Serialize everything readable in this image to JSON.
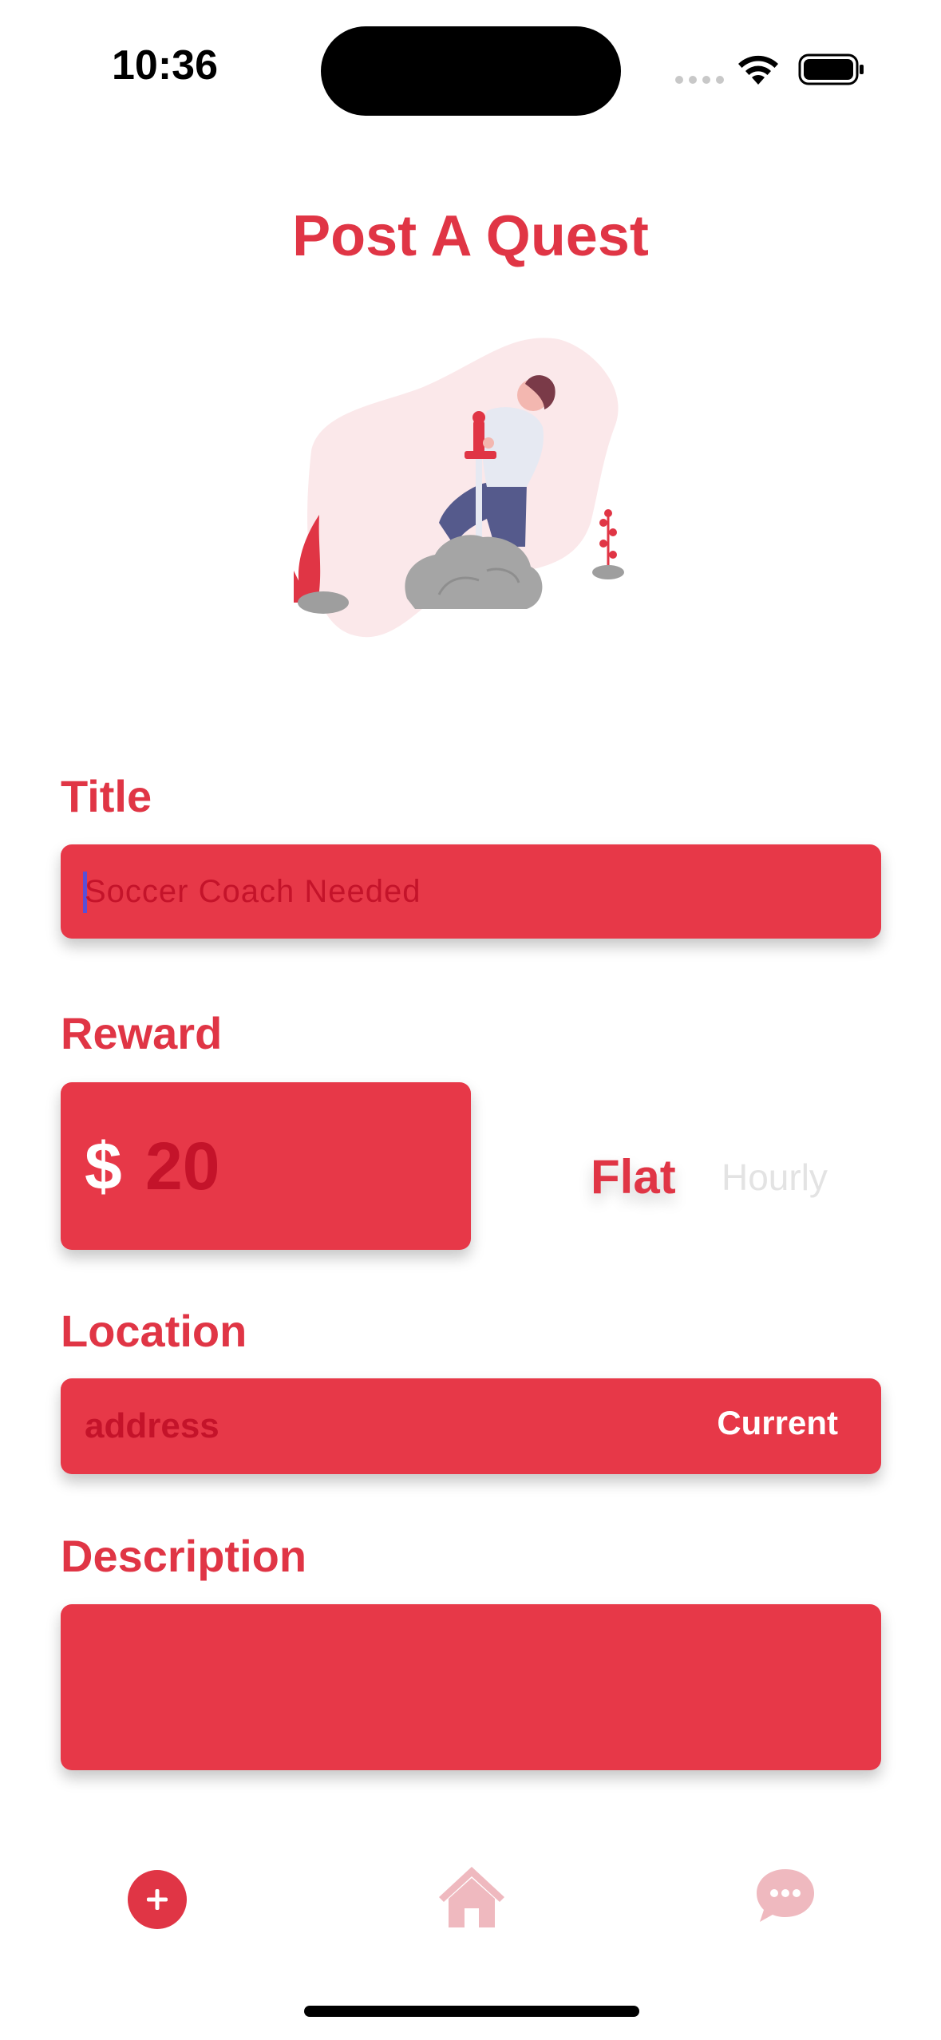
{
  "status_bar": {
    "time": "10:36"
  },
  "header": {
    "title": "Post A Quest"
  },
  "form": {
    "title_label": "Title",
    "title_value": "Soccer Coach Needed",
    "reward_label": "Reward",
    "reward_currency": "$",
    "reward_value": "20",
    "rate_flat": "Flat",
    "rate_hourly": "Hourly",
    "rate_selected": "Flat",
    "location_label": "Location",
    "location_placeholder": "address",
    "location_current_button": "Current",
    "description_label": "Description",
    "description_value": ""
  },
  "tab_bar": {
    "items": [
      {
        "icon": "plus-circle-icon",
        "active": true
      },
      {
        "icon": "home-icon",
        "active": false
      },
      {
        "icon": "chat-bubble-icon",
        "active": false
      }
    ]
  },
  "colors": {
    "accent": "#e03545",
    "field_background": "#e73848",
    "field_text": "#c4132a",
    "inactive_tab": "#efb9bf",
    "inactive_text": "#e3e3e3"
  }
}
